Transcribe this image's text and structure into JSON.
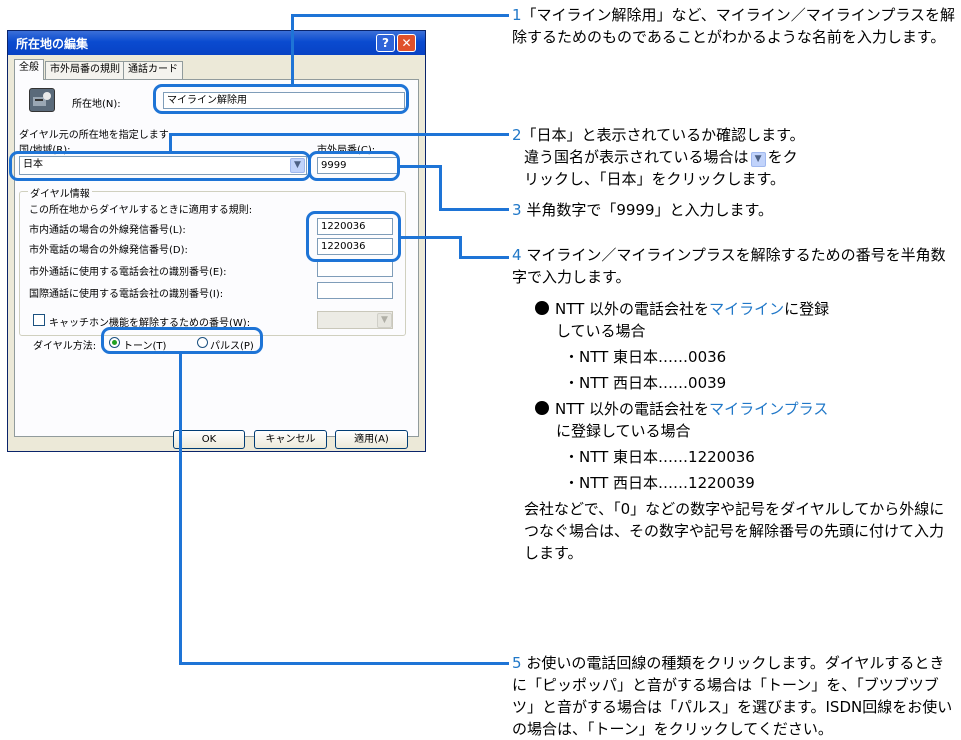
{
  "dialog": {
    "title": "所在地の編集",
    "help_glyph": "?",
    "close_glyph": "✕",
    "tabs": [
      "全般",
      "市外局番の規則",
      "通話カード"
    ],
    "location_label": "所在地(N):",
    "location_value": "マイライン解除用",
    "specify_label": "ダイヤル元の所在地を指定します",
    "country_label": "国/地域(R):",
    "country_value": "日本",
    "area_code_label": "市外局番(C):",
    "area_code_value": "9999",
    "group_title": "ダイヤル情報",
    "rules_label": "この所在地からダイヤルするときに適用する規則:",
    "local_label": "市内通話の場合の外線発信番号(L):",
    "local_value": "1220036",
    "long_label": "市外電話の場合の外線発信番号(D):",
    "long_value": "1220036",
    "carrier_long_label": "市外通話に使用する電話会社の識別番号(E):",
    "carrier_long_value": "",
    "carrier_intl_label": "国際通話に使用する電話会社の識別番号(I):",
    "carrier_intl_value": "",
    "catch_label": "キャッチホン機能を解除するための番号(W):",
    "dial_method_label": "ダイヤル方法:",
    "tone_label": "トーン(T)",
    "pulse_label": "パルス(P)",
    "ok_label": "OK",
    "cancel_label": "キャンセル",
    "apply_label": "適用(A)"
  },
  "notes": {
    "n1_num": "1",
    "n1_text": "「マイライン解除用」など、マイライン／マイラインプラスを解除するためのものであることがわかるような名前を入力します。",
    "n2_num": "2",
    "n2_line1": "「日本」と表示されているか確認します。",
    "n2_line2a": "違う国名が表示されている場合は",
    "n2_line2b": "をク",
    "n2_line3": "リックし、「日本」をクリックします。",
    "n3_num": "3",
    "n3_text": "半角数字で「9999」と入力します。",
    "n4_num": "4",
    "n4_text": "マイライン／マイラインプラスを解除するための番号を半角数字で入力します。",
    "n4_b1_a": "NTT 以外の電話会社を",
    "n4_b1_link": "マイライン",
    "n4_b1_b": "に登録",
    "n4_b1_c": "している場合",
    "n4_b1_east": "・NTT 東日本……0036",
    "n4_b1_west": "・NTT 西日本……0039",
    "n4_b2_a": "NTT 以外の電話会社を",
    "n4_b2_link": "マイラインプラス",
    "n4_b2_c": "に登録している場合",
    "n4_b2_east": "・NTT 東日本……1220036",
    "n4_b2_west": "・NTT 西日本……1220039",
    "n4_tail": "会社などで、「0」などの数字や記号をダイヤルしてから外線につなぐ場合は、その数字や記号を解除番号の先頭に付けて入力します。",
    "n5_num": "5",
    "n5_text": "お使いの電話回線の種類をクリックします。ダイヤルするときに「ピッポッパ」と音がする場合は「トーン」を、「ブツブツブツ」と音がする場合は「パルス」を選びます。ISDN回線をお使いの場合は、「トーン」をクリックしてください。"
  },
  "colors": {
    "accent": "#1e74d6",
    "link": "#2178c8",
    "titlebar": "#0a4bd0",
    "dialog_bg": "#ece9d8"
  },
  "icons": {
    "dropdown": "chevron-down-icon",
    "location": "phone-location-icon",
    "help": "help-icon",
    "close": "close-icon"
  }
}
